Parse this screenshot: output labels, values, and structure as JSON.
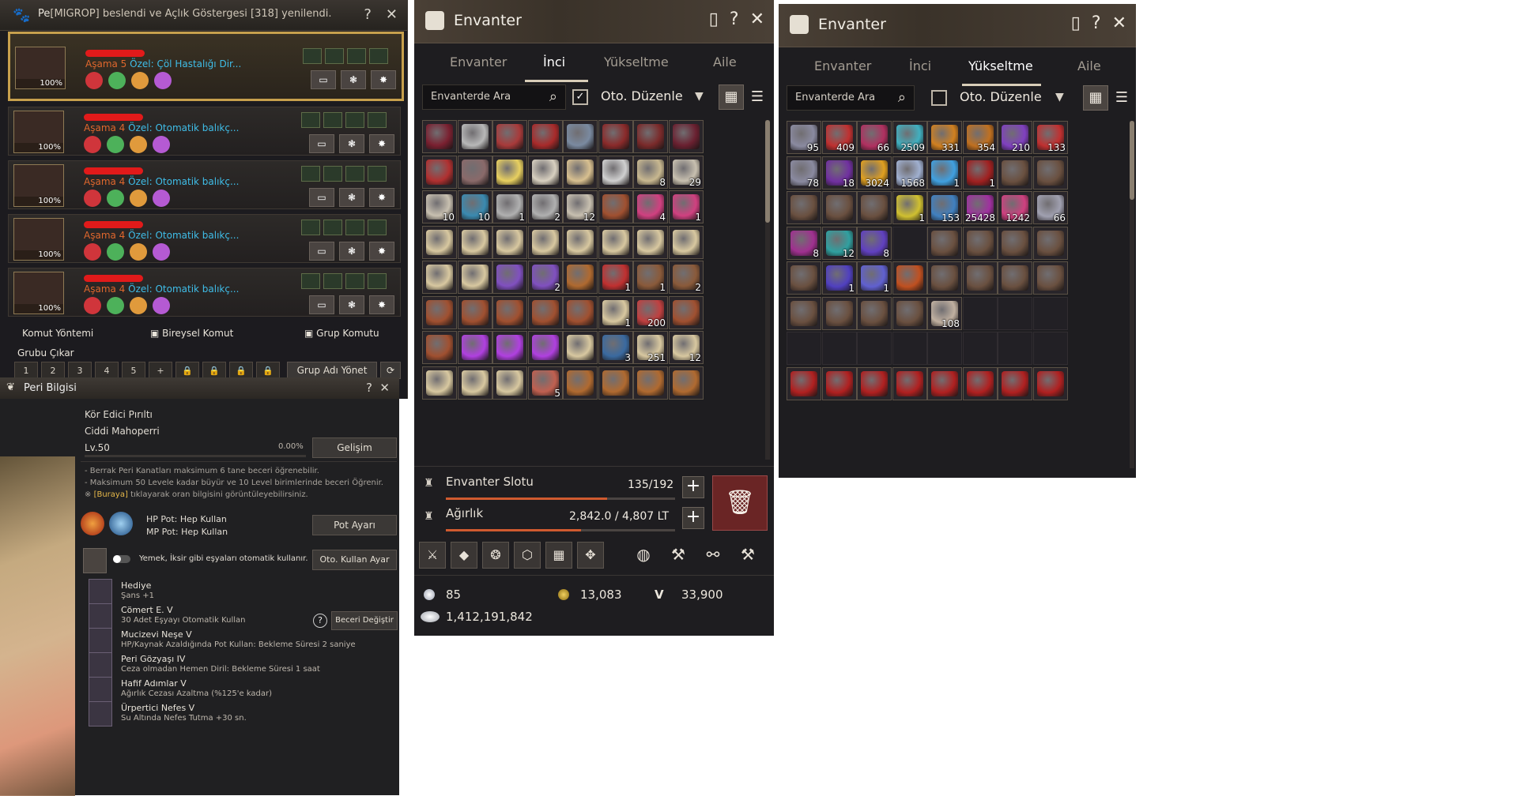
{
  "pet_panel": {
    "title_prefix": "Pe",
    "title_notice": "[MIGROP] beslendi ve Açlık Göstergesi [318] yenilendi.",
    "pets": [
      {
        "stage": "Aşama 5",
        "special": "Özel: Çöl Hastalığı Dir...",
        "percent": "100%"
      },
      {
        "stage": "Aşama 4",
        "special": "Özel: Otomatik balıkç...",
        "percent": "100%"
      },
      {
        "stage": "Aşama 4",
        "special": "Özel: Otomatik balıkç...",
        "percent": "100%"
      },
      {
        "stage": "Aşama 4",
        "special": "Özel: Otomatik balıkç...",
        "percent": "100%"
      },
      {
        "stage": "Aşama 4",
        "special": "Özel: Otomatik balıkç...",
        "percent": "100%"
      }
    ],
    "footer": {
      "komut_yontemi": "Komut Yöntemi",
      "bireysel_komut": "Bireysel Komut",
      "grup_komutu": "Grup Komutu",
      "grubu_cikar": "Grubu Çıkar",
      "group_slots": [
        "1",
        "2",
        "3",
        "4",
        "5"
      ],
      "grup_adi_yonet": "Grup Adı Yönet"
    },
    "help_icon": "?",
    "close_icon": "✕"
  },
  "peri_panel": {
    "title": "Peri Bilgisi",
    "name": "Kör Edici Pırıltı",
    "type": "Ciddi Mahoperri",
    "level": "Lv.50",
    "level_pct": "0.00%",
    "level_progress": 0,
    "gelisim": "Gelişim",
    "info_1": "- Berrak Peri Kanatları maksimum 6 tane beceri öğrenebilir.",
    "info_2": "- Maksimum 50 Levele kadar büyür ve 10 Level birimlerinde beceri Öğrenir.",
    "info_3_prefix": "※",
    "info_3_link": "[Buraya]",
    "info_3_suffix": "tıklayarak oran bilgisini görüntüleyebilirsiniz.",
    "hp_pot": "HP Pot: Hep Kullan",
    "mp_pot": "MP Pot: Hep Kullan",
    "pot_ayari": "Pot Ayarı",
    "auto_use_text": "Yemek, İksir gibi eşyaları otomatik kullanır.",
    "oto_kullan_ayar": "Oto. Kullan Ayar",
    "skills": [
      {
        "name": "Hediye",
        "desc": "Şans +1"
      },
      {
        "name": "Cömert E. V",
        "desc": "30 Adet Eşyayı Otomatik Kullan"
      },
      {
        "name": "Mucizevi Neşe V",
        "desc": "HP/Kaynak Azaldığında Pot Kullan: Bekleme Süresi 2 saniye"
      },
      {
        "name": "Peri Gözyaşı IV",
        "desc": "Ceza olmadan Hemen Diril: Bekleme Süresi 1 saat"
      },
      {
        "name": "Hafif Adımlar V",
        "desc": "Ağırlık Cezası Azaltma (%125'e kadar)"
      },
      {
        "name": "Ürpertici Nefes V",
        "desc": "Su Altında Nefes Tutma +30 sn."
      }
    ],
    "beceri_degistir": "Beceri Değiştir",
    "help_icon": "?",
    "close_icon": "✕"
  },
  "inventory_left": {
    "title": "Envanter",
    "tabs": [
      "Envanter",
      "İnci",
      "Yükseltme",
      "Aile"
    ],
    "active_tab": 1,
    "search_placeholder": "Envanterde Ara",
    "auto_sort": "Oto. Düzenle",
    "auto_sort_checked": "✓",
    "rows": [
      [
        {
          "c": "#7a2030",
          "n": ""
        },
        {
          "c": "#b8b8b8",
          "n": ""
        },
        {
          "c": "#a83a3a",
          "n": ""
        },
        {
          "c": "#a82a2a",
          "n": ""
        },
        {
          "c": "#7a8aa0",
          "n": ""
        },
        {
          "c": "#8a2a2a",
          "n": ""
        },
        {
          "c": "#7a2a2a",
          "n": ""
        },
        {
          "c": "#6a2030",
          "n": ""
        }
      ],
      [
        {
          "c": "#b03030",
          "n": ""
        },
        {
          "c": "#8a6a6a",
          "n": ""
        },
        {
          "c": "#e8d060",
          "n": ""
        },
        {
          "c": "#d8d0c0",
          "n": ""
        },
        {
          "c": "#d8c090",
          "n": ""
        },
        {
          "c": "#d0d0d0",
          "n": ""
        },
        {
          "c": "#c8b890",
          "n": "8"
        },
        {
          "c": "#c8c0b0",
          "n": "29"
        }
      ],
      [
        {
          "c": "#c8c0b0",
          "n": "10"
        },
        {
          "c": "#3a8ab0",
          "n": "10"
        },
        {
          "c": "#b0b0b0",
          "n": "1"
        },
        {
          "c": "#b0b0b0",
          "n": "2"
        },
        {
          "c": "#c8c0b0",
          "n": "12"
        },
        {
          "c": "#a05030",
          "n": ""
        },
        {
          "c": "#d04080",
          "n": "4"
        },
        {
          "c": "#d04080",
          "n": "1"
        }
      ],
      [
        {
          "c": "#d8c8a0",
          "n": ""
        },
        {
          "c": "#d8c8a0",
          "n": ""
        },
        {
          "c": "#d8c8a0",
          "n": ""
        },
        {
          "c": "#d8c8a0",
          "n": ""
        },
        {
          "c": "#d8c8a0",
          "n": ""
        },
        {
          "c": "#d8c8a0",
          "n": ""
        },
        {
          "c": "#d8c8a0",
          "n": ""
        },
        {
          "c": "#d8c8a0",
          "n": ""
        }
      ],
      [
        {
          "c": "#d8c8a0",
          "n": ""
        },
        {
          "c": "#d8c8a0",
          "n": ""
        },
        {
          "c": "#8050c0",
          "n": ""
        },
        {
          "c": "#8050c0",
          "n": "2"
        },
        {
          "c": "#b06a30",
          "n": ""
        },
        {
          "c": "#c03030",
          "n": "1"
        },
        {
          "c": "#8a5a3a",
          "n": "1"
        },
        {
          "c": "#8a5a3a",
          "n": "2"
        }
      ],
      [
        {
          "c": "#a05030",
          "n": ""
        },
        {
          "c": "#a05030",
          "n": ""
        },
        {
          "c": "#a05030",
          "n": ""
        },
        {
          "c": "#a05030",
          "n": ""
        },
        {
          "c": "#a05030",
          "n": ""
        },
        {
          "c": "#d8c8a0",
          "n": "1"
        },
        {
          "c": "#c04040",
          "n": "200"
        },
        {
          "c": "#a05030",
          "n": ""
        }
      ],
      [
        {
          "c": "#a05030",
          "n": ""
        },
        {
          "c": "#b040e0",
          "n": ""
        },
        {
          "c": "#b040e0",
          "n": ""
        },
        {
          "c": "#b040e0",
          "n": ""
        },
        {
          "c": "#d8c8a0",
          "n": ""
        },
        {
          "c": "#3a6aa0",
          "n": "3"
        },
        {
          "c": "#d8c8a0",
          "n": "251"
        },
        {
          "c": "#d8c8a0",
          "n": "12"
        }
      ],
      [
        {
          "c": "#d8c8a0",
          "n": ""
        },
        {
          "c": "#d8c8a0",
          "n": ""
        },
        {
          "c": "#d8c8a0",
          "n": ""
        },
        {
          "c": "#c06050",
          "n": "5"
        },
        {
          "c": "#b06a30",
          "n": ""
        },
        {
          "c": "#b06a30",
          "n": ""
        },
        {
          "c": "#b06a30",
          "n": ""
        },
        {
          "c": "#b06a30",
          "n": ""
        }
      ]
    ],
    "slot_label": "Envanter Slotu",
    "slot_value": "135/192",
    "slot_progress": 0.703,
    "weight_label": "Ağırlık",
    "weight_value": "2,842.0 / 4,807 LT",
    "weight_progress": 0.591,
    "silver_small": "85",
    "gold": "13,083",
    "v_symbol": "V",
    "v_points": "33,900",
    "silver_total": "1,412,191,842",
    "trash_icon": "🗑",
    "plus": "+"
  },
  "inventory_right": {
    "title": "Envanter",
    "tabs": [
      "Envanter",
      "İnci",
      "Yükseltme",
      "Aile"
    ],
    "active_tab": 2,
    "search_placeholder": "Envanterde Ara",
    "auto_sort": "Oto. Düzenle",
    "rows": [
      [
        {
          "c": "#8a8aa0",
          "n": "95"
        },
        {
          "c": "#c03030",
          "n": "409"
        },
        {
          "c": "#b03060",
          "n": "66"
        },
        {
          "c": "#40b0c0",
          "n": "2509"
        },
        {
          "c": "#d08020",
          "n": "331"
        },
        {
          "c": "#c07020",
          "n": "354"
        },
        {
          "c": "#8040c0",
          "n": "210"
        },
        {
          "c": "#c03030",
          "n": "133"
        }
      ],
      [
        {
          "c": "#8a8aa0",
          "n": "78"
        },
        {
          "c": "#7030a0",
          "n": "18"
        },
        {
          "c": "#e0a020",
          "n": "3024"
        },
        {
          "c": "#a0b0d0",
          "n": "1568"
        },
        {
          "c": "#40a0e0",
          "n": "1"
        },
        {
          "c": "#a02020",
          "n": "1"
        },
        {
          "c": "#6a5040",
          "n": ""
        },
        {
          "c": "#6a5040",
          "n": ""
        }
      ],
      [
        {
          "c": "#6a5040",
          "n": ""
        },
        {
          "c": "#6a5040",
          "n": ""
        },
        {
          "c": "#6a5040",
          "n": ""
        },
        {
          "c": "#d0c030",
          "n": "1"
        },
        {
          "c": "#4080c0",
          "n": "153"
        },
        {
          "c": "#a030a0",
          "n": "25428"
        },
        {
          "c": "#d04080",
          "n": "1242"
        },
        {
          "c": "#a0a0b0",
          "n": "66"
        }
      ],
      [
        {
          "c": "#a03090",
          "n": "8"
        },
        {
          "c": "#30a0a0",
          "n": "12"
        },
        {
          "c": "#6040c0",
          "n": "8"
        },
        {
          "c": "",
          "n": ""
        },
        {
          "c": "#6a5040",
          "n": ""
        },
        {
          "c": "#6a5040",
          "n": ""
        },
        {
          "c": "#6a5040",
          "n": ""
        },
        {
          "c": "#6a5040",
          "n": ""
        }
      ],
      [
        {
          "c": "#6a5040",
          "n": ""
        },
        {
          "c": "#5040c0",
          "n": "1"
        },
        {
          "c": "#6060d0",
          "n": "1"
        },
        {
          "c": "#c05020",
          "n": ""
        },
        {
          "c": "#6a5040",
          "n": ""
        },
        {
          "c": "#6a5040",
          "n": ""
        },
        {
          "c": "#6a5040",
          "n": ""
        },
        {
          "c": "#6a5040",
          "n": ""
        }
      ],
      [
        {
          "c": "#6a5040",
          "n": ""
        },
        {
          "c": "#6a5040",
          "n": ""
        },
        {
          "c": "#6a5040",
          "n": ""
        },
        {
          "c": "#6a5040",
          "n": ""
        },
        {
          "c": "#c0b0a0",
          "n": "108"
        },
        {
          "c": "",
          "n": ""
        },
        {
          "c": "",
          "n": ""
        },
        {
          "c": "",
          "n": ""
        }
      ],
      [
        {
          "c": "",
          "n": ""
        },
        {
          "c": "",
          "n": ""
        },
        {
          "c": "",
          "n": ""
        },
        {
          "c": "",
          "n": ""
        },
        {
          "c": "",
          "n": ""
        },
        {
          "c": "",
          "n": ""
        },
        {
          "c": "",
          "n": ""
        },
        {
          "c": "",
          "n": ""
        }
      ],
      [
        {
          "c": "#b02020",
          "n": ""
        },
        {
          "c": "#b02020",
          "n": ""
        },
        {
          "c": "#b02020",
          "n": ""
        },
        {
          "c": "#b02020",
          "n": ""
        },
        {
          "c": "#b02020",
          "n": ""
        },
        {
          "c": "#b02020",
          "n": ""
        },
        {
          "c": "#b02020",
          "n": ""
        },
        {
          "c": "#b02020",
          "n": ""
        }
      ]
    ]
  },
  "colors": {
    "accent_gold": "#c8a34c",
    "stage_orange": "#e0672d",
    "special_blue": "#3fbde8",
    "trash_red": "#6a2525"
  }
}
